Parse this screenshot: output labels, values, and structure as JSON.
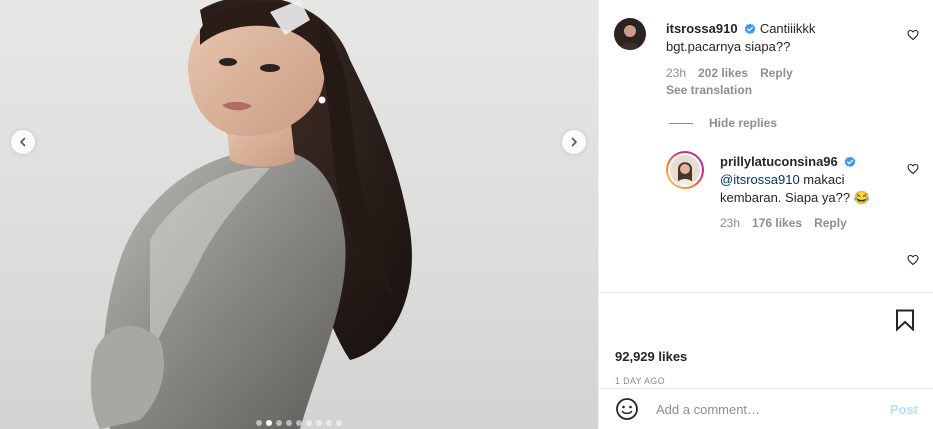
{
  "comments": [
    {
      "username": "itsrossa910",
      "text": "Cantiiikkk bgt.pacarnya siapa??",
      "time": "23h",
      "likes": "202 likes",
      "reply_label": "Reply",
      "see_translation": "See translation"
    },
    {
      "username": "prillylatuconsina96",
      "mention": "@itsrossa910",
      "text": " makaci kembaran. Siapa ya?? 😂",
      "time": "23h",
      "likes": "176 likes",
      "reply_label": "Reply"
    }
  ],
  "hide_replies_label": "Hide replies",
  "post": {
    "likes_count": "92,929 likes",
    "time_ago": "1 DAY AGO"
  },
  "comment_box": {
    "placeholder": "Add a comment…",
    "post_label": "Post"
  },
  "carousel": {
    "slide_count": 9,
    "active_index": 1
  },
  "colors": {
    "verified": "#3897f0",
    "link": "#00376b",
    "muted": "#8e8e8e",
    "post_disabled": "#b2dffc"
  },
  "icons": {
    "prev": "chevron-left-icon",
    "next": "chevron-right-icon",
    "like": "heart-outline-icon",
    "save": "bookmark-icon",
    "emoji": "smiley-icon",
    "verified": "verified-badge-icon"
  }
}
